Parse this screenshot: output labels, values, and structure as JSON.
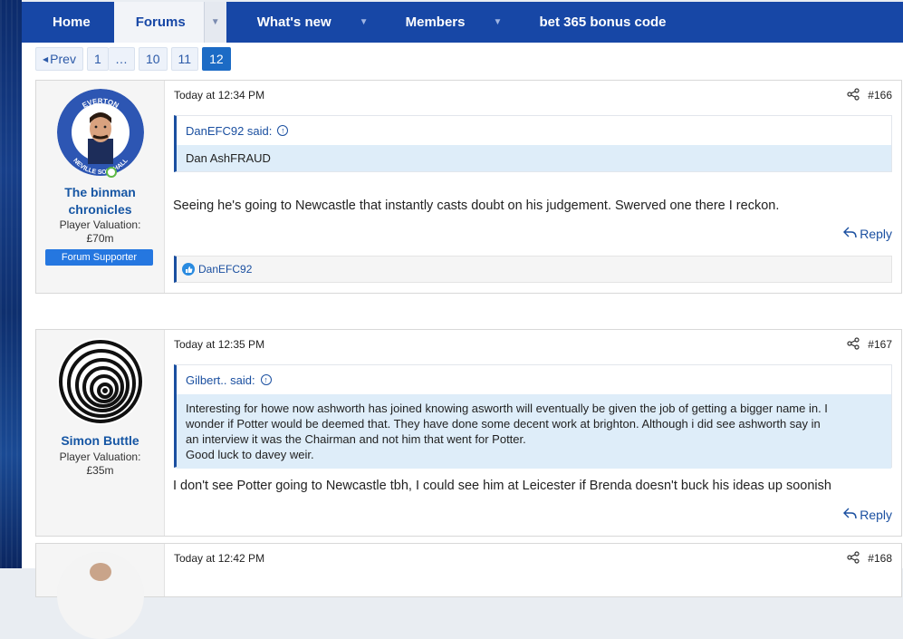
{
  "nav": {
    "home": "Home",
    "forums": "Forums",
    "whats_new": "What's new",
    "members": "Members",
    "promo": "bet 365 bonus code"
  },
  "pagination": {
    "prev": "Prev",
    "first": "1",
    "gap": "…",
    "p10": "10",
    "p11": "11",
    "current": "12"
  },
  "posts": [
    {
      "date": "Today at 12:34 PM",
      "number": "#166",
      "username_line1": "The binman",
      "username_line2": "chronicles",
      "valuation_label": "Player Valuation:",
      "valuation": "£70m",
      "badge": "Forum Supporter",
      "avatar_text_top": "EVERTON",
      "avatar_text_bottom": "NEVILLE SOUTHALL",
      "quote_author": "DanEFC92 said:",
      "quote_text": "Dan AshFRAUD",
      "message": "Seeing he's going to Newcastle that instantly casts doubt on his judgement. Swerved one there I reckon.",
      "reply": "Reply",
      "reaction_user": "DanEFC92"
    },
    {
      "date": "Today at 12:35 PM",
      "number": "#167",
      "username": "Simon Buttle",
      "valuation_label": "Player Valuation:",
      "valuation": "£35m",
      "quote_author": "Gilbert.. said:",
      "quote_lines": [
        "Interesting for howe now ashworth has joined knowing asworth will eventually be given the job of getting a bigger name in. I",
        "wonder if Potter would be deemed that. They have done some decent work at brighton. Although i did see ashworth say in",
        "an interview it was the Chairman and not him that went for Potter.",
        "Good luck to davey weir."
      ],
      "message": "I don't see Potter going to Newcastle tbh, I could see him at Leicester if Brenda doesn't buck his ideas up soonish",
      "reply": "Reply"
    },
    {
      "date": "Today at 12:42 PM",
      "number": "#168"
    }
  ],
  "colors": {
    "nav_bg": "#1747a6",
    "link": "#1656a4",
    "quote_bg": "#deedf9",
    "badge_bg": "#2577e0"
  }
}
